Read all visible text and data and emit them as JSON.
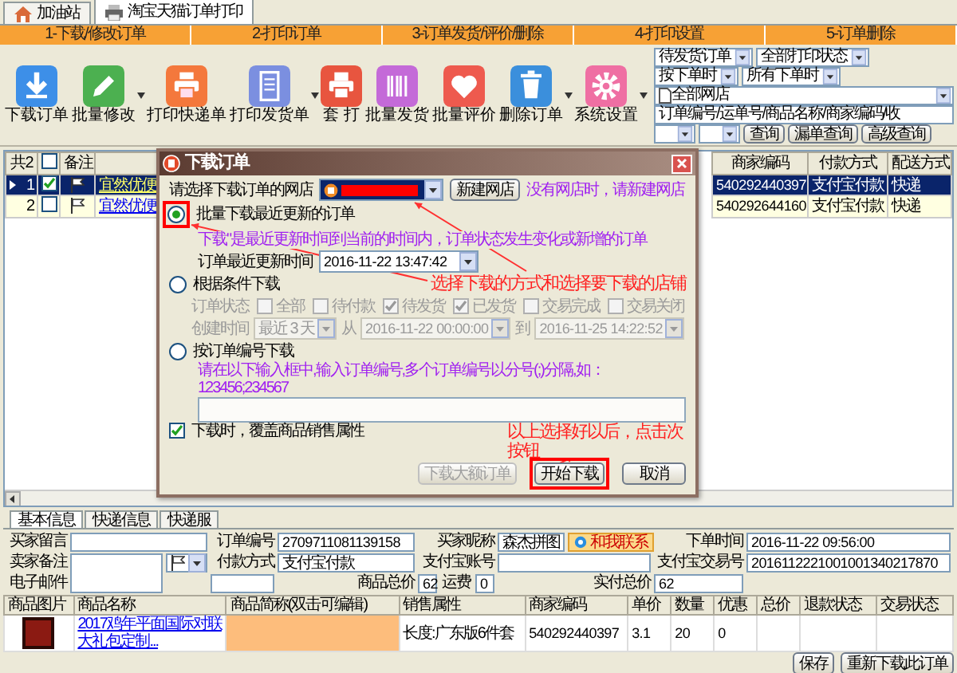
{
  "tabs": [
    {
      "label": "加油站",
      "selected": false
    },
    {
      "label": "淘宝天猫订单打印",
      "selected": true
    }
  ],
  "steps": [
    "1-下载/修改订单",
    "2-打印订单",
    "3-订单发货/评价/删除",
    "4-打印设置",
    "5-订单删除"
  ],
  "toolbar": [
    {
      "label": "下载订单",
      "dropdown": false
    },
    {
      "label": "批量修改",
      "dropdown": true
    },
    {
      "label": "打印快递单",
      "dropdown": false
    },
    {
      "label": "打印发货单",
      "dropdown": true
    },
    {
      "label": "套 打",
      "dropdown": false
    },
    {
      "label": "批量发货",
      "dropdown": false
    },
    {
      "label": "批量评价",
      "dropdown": false
    },
    {
      "label": "删除订单",
      "dropdown": true
    },
    {
      "label": "系统设置",
      "dropdown": true
    }
  ],
  "filters": {
    "selects": [
      "待发货订单",
      "全部打印状态",
      "按下单时",
      "所有下单时"
    ],
    "shop": "全部网店",
    "search_text": "订单编号/运单号/商品名称/商家编码/收",
    "buttons": [
      "查询",
      "漏单查询",
      "高级查询"
    ]
  },
  "orders": {
    "count_label": "共2",
    "all_checked": false,
    "note_header": "备注",
    "columns_right": [
      "商家编码",
      "付款方式",
      "配送方式"
    ],
    "rows": [
      {
        "index": "1",
        "selected": true,
        "checked": true,
        "buyer": "宜然优便",
        "code": "540292440397",
        "payment": "支付宝付款",
        "shipping": "快递"
      },
      {
        "index": "2",
        "selected": false,
        "checked": false,
        "buyer": "宜然优便",
        "code": "540292644160",
        "payment": "支付宝付款",
        "shipping": "快递"
      }
    ]
  },
  "dialog": {
    "title": "下载订单",
    "shop_label": "请选择下载订单的网店",
    "new_shop_button": "新建网店",
    "new_shop_hint": "没有网店时，请新建网店",
    "modes": [
      {
        "label": "批量下载最近更新的订单",
        "selected": true
      },
      {
        "label": "根据条件下载",
        "selected": false
      },
      {
        "label": "按订单编号下载",
        "selected": false
      }
    ],
    "recent_hint": "下载\"是最近更新时间到当前的时间内，订单状态发生变化或新增的订单",
    "recent_time_label": "订单最近更新时间",
    "recent_time": "2016-11-22 13:47:42",
    "status_label": "订单状态",
    "statuses": [
      {
        "label": "全部",
        "checked": false
      },
      {
        "label": "待付款",
        "checked": false
      },
      {
        "label": "待发货",
        "checked": true
      },
      {
        "label": "已发货",
        "checked": true
      },
      {
        "label": "交易完成",
        "checked": false
      },
      {
        "label": "交易关闭",
        "checked": false
      }
    ],
    "created_label": "创建时间",
    "created_range": "最近 3 天",
    "from_label": "从",
    "from": "2016-11-22 00:00:00",
    "to_label": "到",
    "to": "2016-11-25 14:22:52",
    "ids_hint": "请在以下输入框中,输入订单编号,多个订单编号以分号(;)分隔,如：123456;234567",
    "overwrite": {
      "label": "下载时，覆盖商品销售属性",
      "checked": true
    },
    "buttons": [
      {
        "label": "下载大额订单",
        "disabled": true
      },
      {
        "label": "开始下载",
        "disabled": false
      },
      {
        "label": "取消",
        "disabled": false
      }
    ],
    "annotations": [
      "选择下载的方式和选择要下载的店铺",
      "以上选择好以后，点击次按钮"
    ]
  },
  "detail": {
    "tabs": [
      {
        "label": "基本信息",
        "selected": true
      },
      {
        "label": "快递信息",
        "selected": false
      },
      {
        "label": "快递服",
        "selected": false
      }
    ],
    "buyer_message_label": "买家留言",
    "seller_note_label": "卖家备注",
    "order_no": {
      "label": "订单编号",
      "value": "2709711081139158"
    },
    "buyer_nick": {
      "label": "买家昵称",
      "value": "森杰拼图",
      "contact": "和我联系"
    },
    "order_time": {
      "label": "下单时间",
      "value": "2016-11-22 09:56:00"
    },
    "payment_method": {
      "label": "付款方式",
      "value": "支付宝付款"
    },
    "alipay_account_label": "支付宝账号",
    "alipay_trade_no": {
      "label": "支付宝交易号",
      "value": "2016112221001001340217870"
    },
    "email_label": "电子邮件",
    "goods_total": {
      "label": "商品总价",
      "value": "62"
    },
    "shipping_fee": {
      "label": "运费",
      "value": "0"
    },
    "paid_total": {
      "label": "实付总价",
      "value": "62"
    },
    "products": {
      "columns": [
        "商品图片",
        "商品名称",
        "商品简称(双击可编辑)",
        "销售属性",
        "商家编码",
        "单价",
        "数量",
        "优惠",
        "总价",
        "退款状态",
        "交易状态"
      ],
      "rows": [
        {
          "name": "2017鸡年平面国际对联大礼包定制...",
          "attr": "长度:广东版6件套",
          "code": "540292440397",
          "price": "3.1",
          "qty": "20",
          "discount": "0"
        }
      ]
    }
  },
  "bottom_buttons": [
    "保存",
    "重新下载此订单"
  ]
}
